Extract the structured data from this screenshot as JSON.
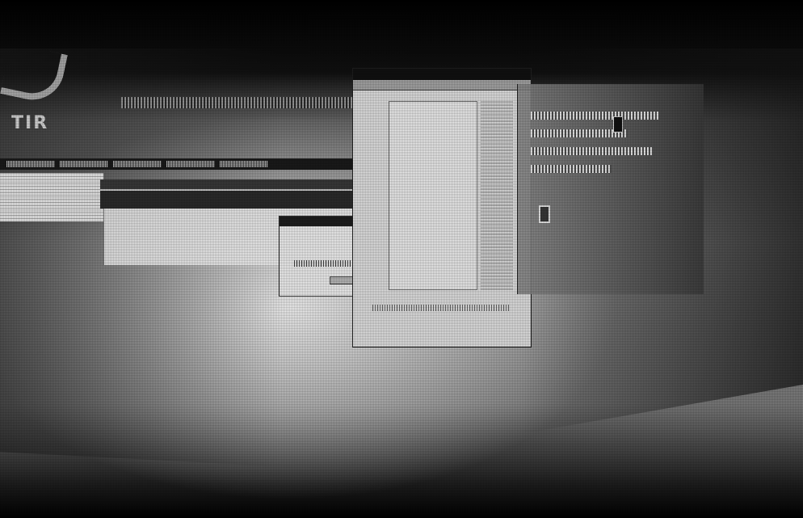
{
  "brand": {
    "text": "TIR"
  }
}
